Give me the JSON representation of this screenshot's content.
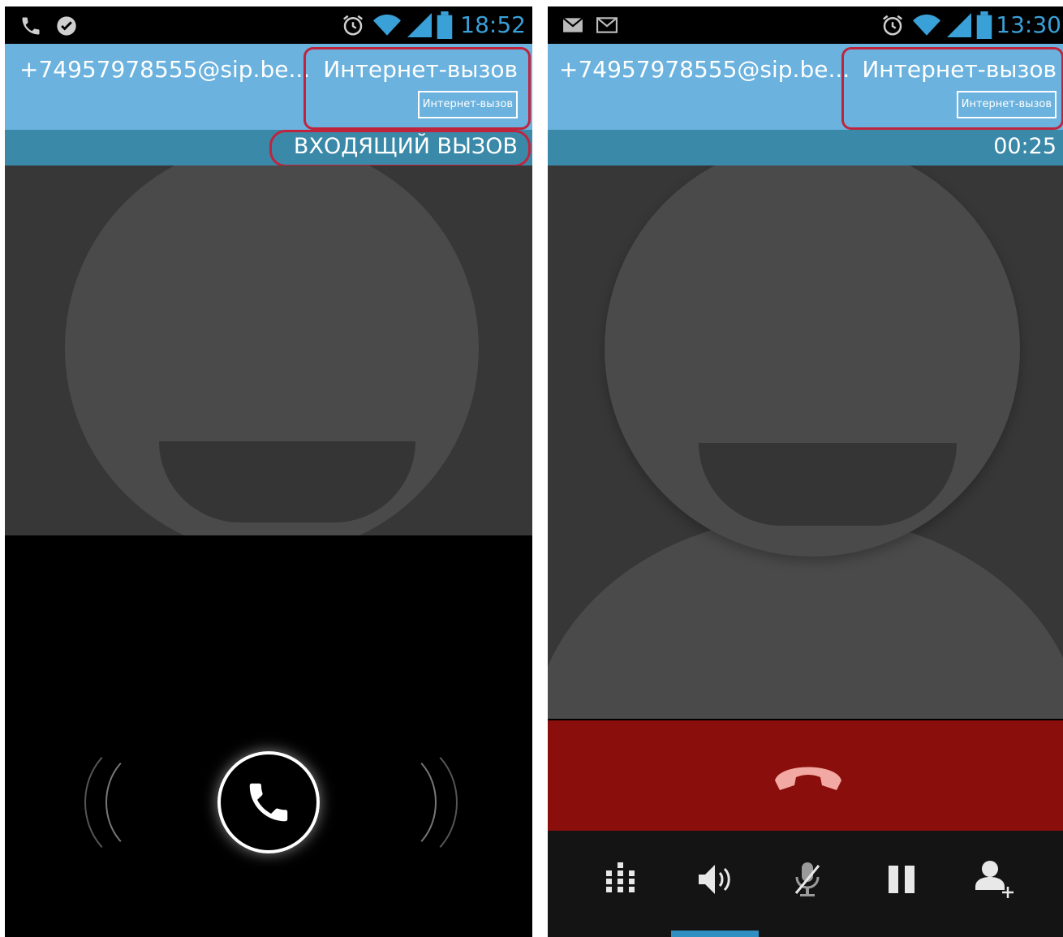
{
  "left_screen": {
    "status_bar": {
      "icons": [
        "phone-icon",
        "check-badge-icon",
        "alarm-icon",
        "wifi-icon",
        "signal-icon",
        "battery-icon"
      ],
      "time": "18:52"
    },
    "header": {
      "contact": "+74957978555@sip.be...",
      "call_type": "Интернет-вызов",
      "call_type_badge": "Интернет-вызов"
    },
    "state_label": "ВХОДЯЩИЙ ВЫЗОВ",
    "answer_control": {
      "icon": "phone-answer-icon"
    }
  },
  "right_screen": {
    "status_bar": {
      "icons": [
        "email-icon",
        "mail-icon",
        "alarm-icon",
        "wifi-icon",
        "signal-icon",
        "battery-icon"
      ],
      "time": "13:30"
    },
    "header": {
      "contact": "+74957978555@sip.be...",
      "call_type": "Интернет-вызов",
      "call_type_badge": "Интернет-вызов"
    },
    "call_duration": "00:25",
    "end_call": {
      "icon": "end-call-icon"
    },
    "controls": [
      {
        "icon": "dialpad-icon"
      },
      {
        "icon": "speaker-icon"
      },
      {
        "icon": "mute-mic-icon"
      },
      {
        "icon": "pause-icon"
      },
      {
        "icon": "add-contact-icon"
      }
    ]
  },
  "colors": {
    "header": "#6bb2de",
    "state_bar": "#3b89a8",
    "highlight": "#c0243d",
    "end_call": "#8a0e0b",
    "status_time": "#3aa0d8"
  }
}
